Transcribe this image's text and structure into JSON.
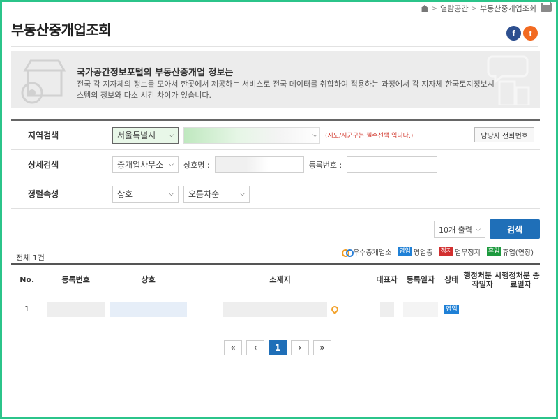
{
  "breadcrumb": {
    "items": [
      "열람공간",
      "부동산중개업조회"
    ]
  },
  "page": {
    "title": "부동산중개업조회"
  },
  "banner": {
    "heading": "국가공간정보포털의 부동산중개업 정보는",
    "text": "전국 각 지자체의 정보를 모아서 한곳에서 제공하는 서비스로 전국 데이터를 취합하여 적용하는 과정에서 각 지자체 한국토지정보시스템의 정보와 다소 시간 차이가 있습니다."
  },
  "form": {
    "region": {
      "label": "지역검색",
      "city": "서울특별시",
      "note": "(시도/시군구는 필수선택 입니다.)",
      "contact_button": "담당자 전화번호"
    },
    "detail": {
      "label": "상세검색",
      "type": "중개업사무소",
      "name_label": "상호명 :",
      "reg_label": "등록번호 :"
    },
    "sort": {
      "label": "정렬속성",
      "field": "상호",
      "order": "오름차순"
    }
  },
  "controls": {
    "per_page": "10개 출력",
    "search_button": "검색"
  },
  "results": {
    "total": "전체 1건",
    "legend": [
      {
        "badge": "",
        "label": "우수중개업소"
      },
      {
        "badge": "영업",
        "label": "영업중"
      },
      {
        "badge": "정지",
        "label": "업무정지"
      },
      {
        "badge": "휴업",
        "label": "휴업(연장)"
      }
    ],
    "columns": [
      "No.",
      "등록번호",
      "상호",
      "소재지",
      "대표자",
      "등록일자",
      "상태",
      "행정처분 시작일자",
      "행정처분 종료일자"
    ],
    "rows": [
      {
        "no": "1",
        "status": "영업"
      }
    ]
  },
  "pagination": {
    "first": "«",
    "prev": "‹",
    "current": "1",
    "next": "›",
    "last": "»"
  },
  "colors": {
    "accent": "#1f6fb8",
    "open": "#1f80d6",
    "stop": "#d22f2f",
    "rest": "#1d9a3e",
    "frame": "#2bc48a"
  }
}
